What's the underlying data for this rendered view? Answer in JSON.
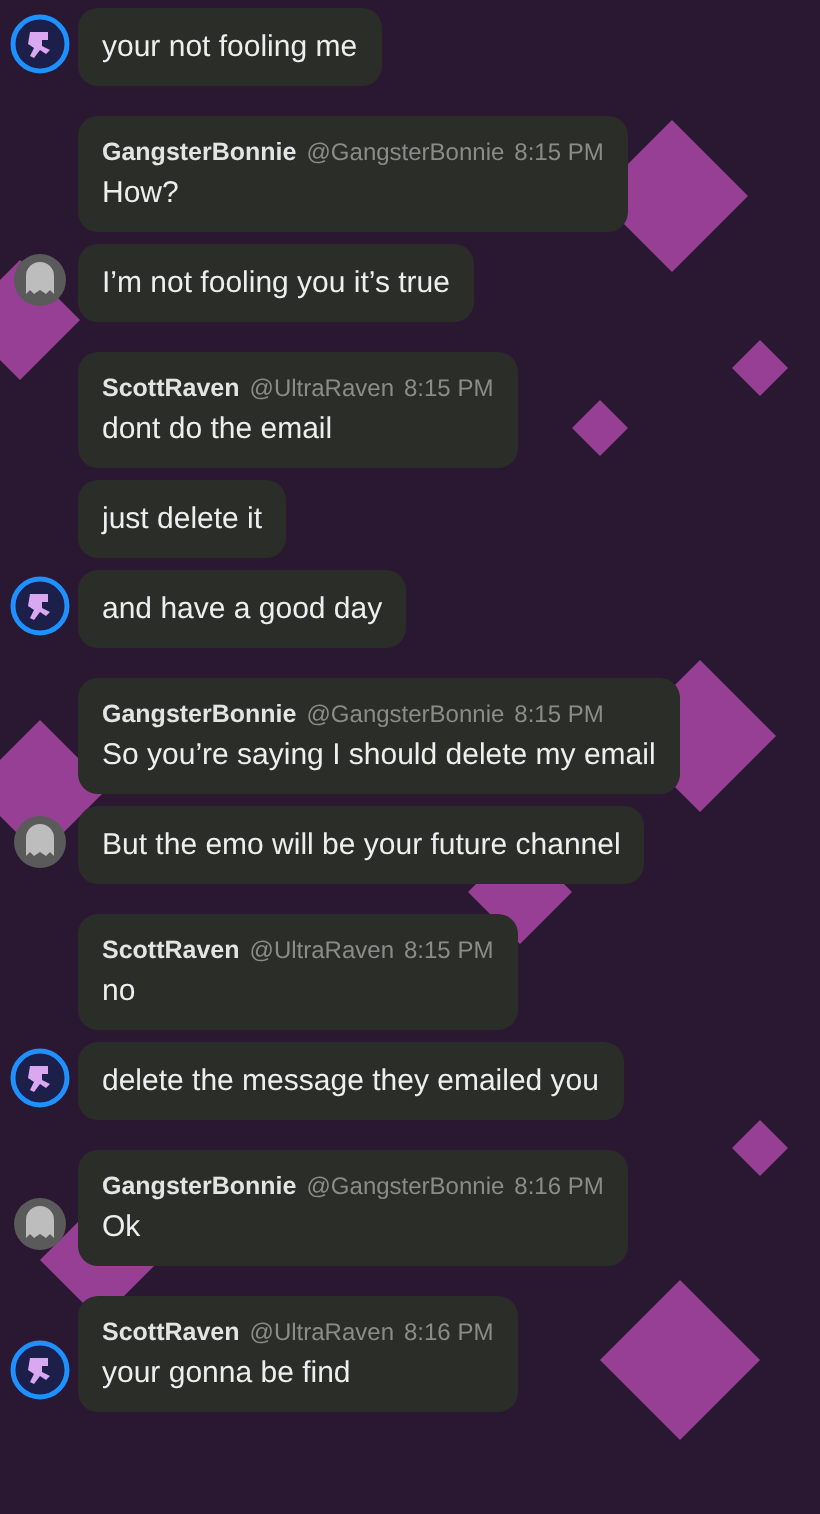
{
  "groups": [
    {
      "avatar": {
        "kind": "robot"
      },
      "messages": [
        "your not fooling me"
      ]
    },
    {
      "author": "GangsterBonnie",
      "handle": "@GangsterBonnie",
      "time": "8:15 PM",
      "avatar": {
        "kind": "ghost"
      },
      "messages": [
        "How?",
        "I’m not fooling you it’s true"
      ]
    },
    {
      "author": "ScottRaven",
      "handle": "@UltraRaven",
      "time": "8:15 PM",
      "avatar": {
        "kind": "robot"
      },
      "messages": [
        "dont do the email",
        "just delete it",
        "and have a good day"
      ]
    },
    {
      "author": "GangsterBonnie",
      "handle": "@GangsterBonnie",
      "time": "8:15 PM",
      "avatar": {
        "kind": "ghost"
      },
      "messages": [
        "So you’re saying I should delete my email",
        "But the emo will be your future channel"
      ]
    },
    {
      "author": "ScottRaven",
      "handle": "@UltraRaven",
      "time": "8:15 PM",
      "avatar": {
        "kind": "robot"
      },
      "messages": [
        "no",
        "delete the message they emailed you"
      ]
    },
    {
      "author": "GangsterBonnie",
      "handle": "@GangsterBonnie",
      "time": "8:16 PM",
      "avatar": {
        "kind": "ghost"
      },
      "messages": [
        "Ok"
      ]
    },
    {
      "author": "ScottRaven",
      "handle": "@UltraRaven",
      "time": "8:16 PM",
      "avatar": {
        "kind": "robot"
      },
      "messages": [
        "your gonna be find"
      ]
    }
  ]
}
